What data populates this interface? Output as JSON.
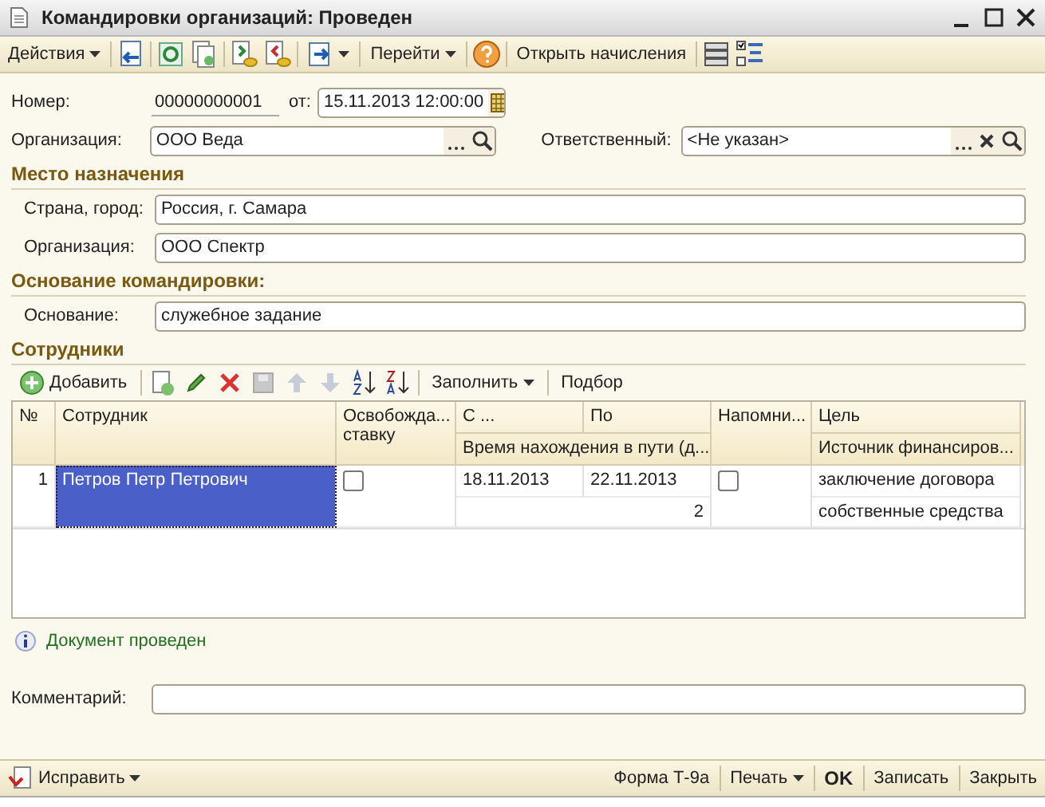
{
  "window": {
    "title": "Командировки организаций: Проведен"
  },
  "toolbar": {
    "actions_menu": "Действия",
    "goto_menu": "Перейти",
    "open_accruals": "Открыть начисления"
  },
  "header": {
    "number_label": "Номер:",
    "number": "00000000001",
    "date_label": "от:",
    "date": "15.11.2013 12:00:00",
    "organization_label": "Организация:",
    "organization": "ООО Веда",
    "responsible_label": "Ответственный:",
    "responsible": "<Не указан>"
  },
  "destination": {
    "title": "Место назначения",
    "fields": [
      {
        "label": "Страна, город:",
        "value": "Россия, г. Самара"
      },
      {
        "label": "Организация:",
        "value": "ООО Спектр"
      }
    ]
  },
  "basis": {
    "title": "Основание командировки:",
    "fields": [
      {
        "label": "Основание:",
        "value": "служебное задание"
      }
    ]
  },
  "employees": {
    "title": "Сотрудники",
    "toolbar": {
      "add": "Добавить",
      "fill_menu": "Заполнить",
      "pick": "Подбор"
    },
    "columns": {
      "number": "№",
      "employee": "Сотрудник",
      "release_rate": "Освобожда... ставку",
      "from": "С ...",
      "to": "По",
      "travel_days": "Время нахождения в пути (д...",
      "remind": "Напомни...",
      "purpose": "Цель",
      "funding": "Источник финансиров..."
    },
    "rows": [
      {
        "number": "1",
        "employee": "Петров Петр Петрович",
        "selected": true,
        "release_rate": false,
        "from": "18.11.2013",
        "to": "22.11.2013",
        "travel_days": "2",
        "remind": false,
        "purpose": "заключение договора",
        "funding": "собственные средства"
      }
    ]
  },
  "info": "Документ проведен",
  "comment": {
    "label": "Комментарий:"
  },
  "bottom_bar": {
    "fix_menu": "Исправить",
    "form": "Форма Т-9а",
    "print_menu": "Печать",
    "ok": "OK",
    "save": "Записать",
    "close": "Закрыть"
  }
}
